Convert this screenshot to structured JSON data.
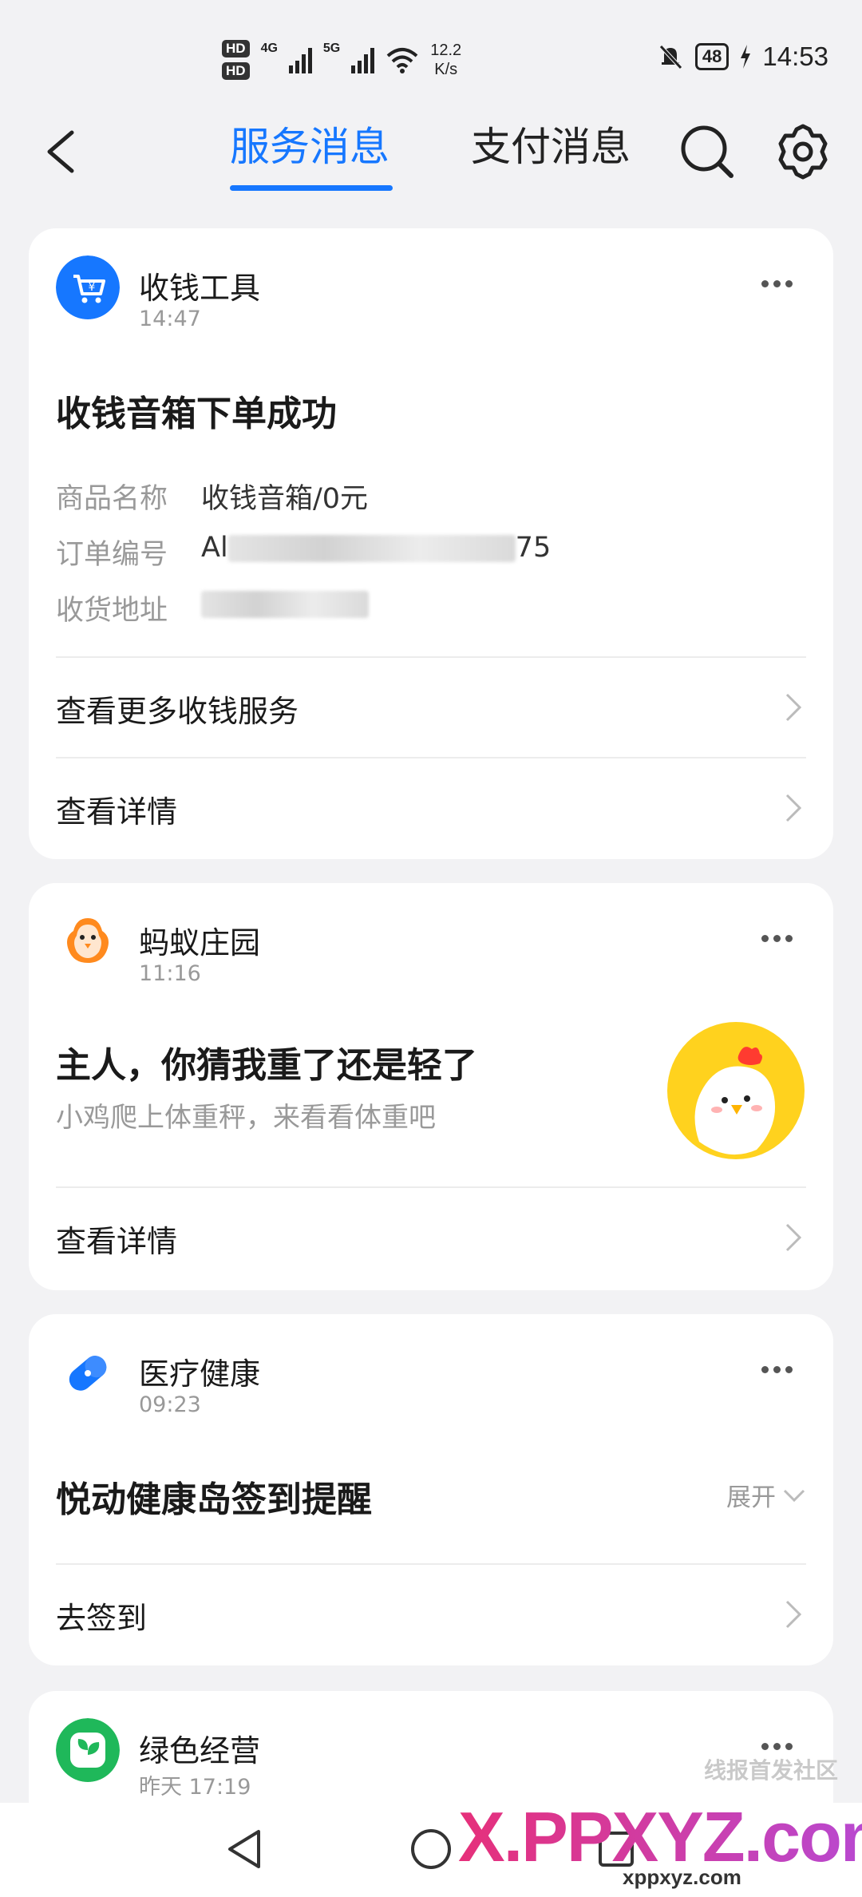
{
  "status_bar": {
    "hd1": "HD",
    "hd2": "HD",
    "net1": "4G",
    "net2": "5G",
    "speed_value": "12.2",
    "speed_unit": "K/s",
    "battery": "48",
    "time": "14:53"
  },
  "header": {
    "tabs": [
      {
        "label": "服务消息",
        "active": true
      },
      {
        "label": "支付消息",
        "active": false
      }
    ],
    "search_icon": "search-icon",
    "settings_icon": "gear-icon",
    "accent_color": "#1677ff"
  },
  "cards": [
    {
      "app_name": "收钱工具",
      "time": "14:47",
      "title": "收钱音箱下单成功",
      "fields": [
        {
          "key": "商品名称",
          "value": "收钱音箱/0元"
        },
        {
          "key": "订单编号",
          "value_prefix": "Al",
          "value_suffix": "75"
        },
        {
          "key": "收货地址",
          "value_prefix": "",
          "value_suffix": ""
        }
      ],
      "links": [
        "查看更多收钱服务",
        "查看详情"
      ]
    },
    {
      "app_name": "蚂蚁庄园",
      "time": "11:16",
      "title": "主人，你猜我重了还是轻了",
      "subtitle": "小鸡爬上体重秤，来看看体重吧",
      "links": [
        "查看详情"
      ]
    },
    {
      "app_name": "医疗健康",
      "time": "09:23",
      "title": "悦动健康岛签到提醒",
      "expand_label": "展开",
      "links": [
        "去签到"
      ]
    },
    {
      "app_name": "绿色经营",
      "time": "昨天 17:19"
    }
  ],
  "watermark": {
    "site": "X.PPXYZ.com",
    "community": "线报首发社区",
    "small": "xppxyz.com"
  }
}
